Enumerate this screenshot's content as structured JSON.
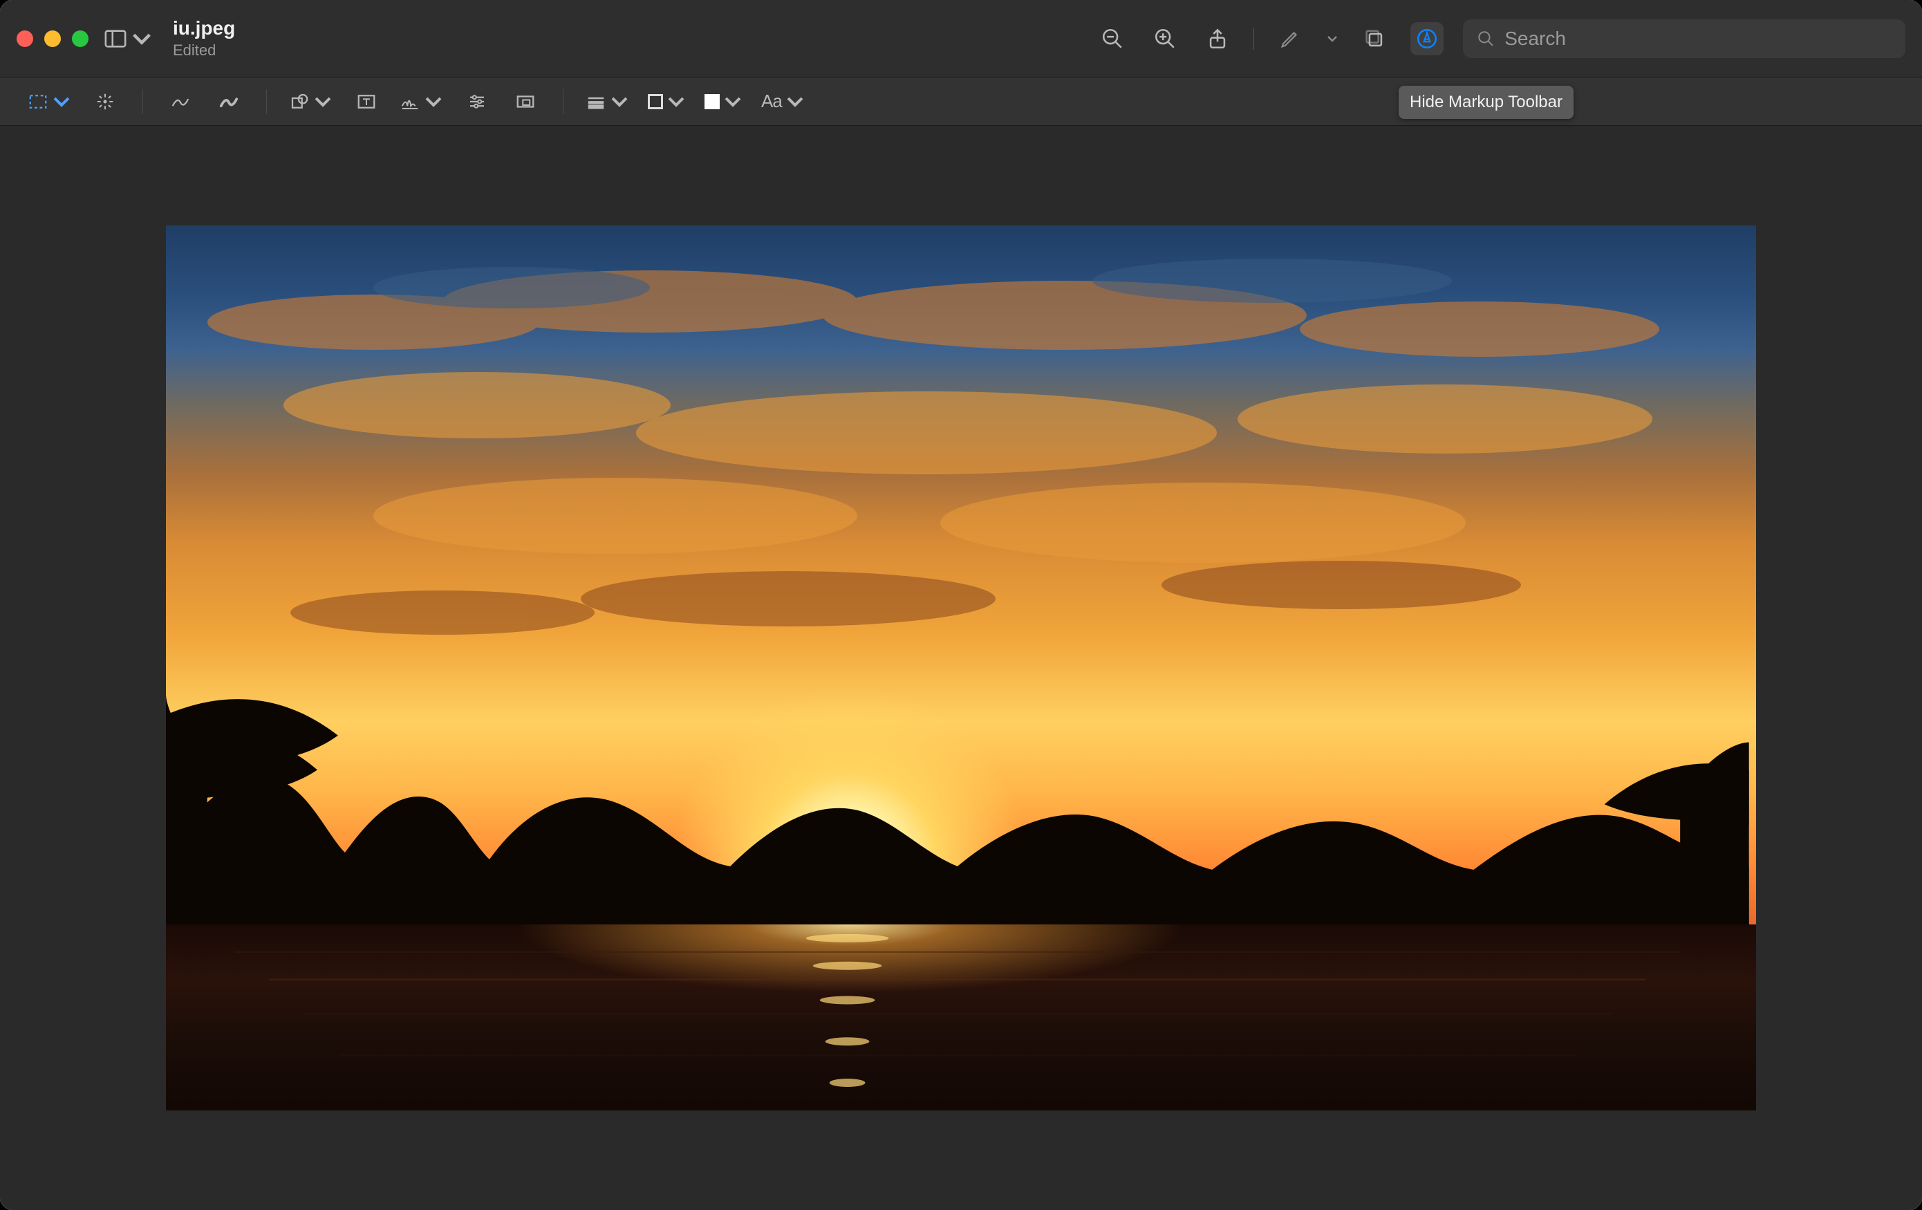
{
  "window": {
    "file_title": "iu.jpeg",
    "subtitle": "Edited"
  },
  "toolbar": {
    "search_placeholder": "Search"
  },
  "tooltip": {
    "markup_toggle": "Hide Markup Toolbar"
  },
  "markup": {
    "shape_style_indicator": "line",
    "text_style_label": "Aa"
  },
  "icons": {
    "sidebar": "sidebar-icon",
    "zoom_out": "zoom-out-icon",
    "zoom_in": "zoom-in-icon",
    "share": "share-icon",
    "highlight": "highlight-icon",
    "rotate": "rotate-icon",
    "markup": "markup-icon",
    "search": "search-icon",
    "select": "rectangular-selection-icon",
    "instant_alpha": "instant-alpha-icon",
    "sketch": "sketch-icon",
    "draw": "draw-icon",
    "shapes": "shapes-icon",
    "text_box": "text-icon",
    "sign": "sign-icon",
    "adjust_color": "adjust-color-icon",
    "adjust_size": "adjust-size-icon",
    "shape_style": "shape-style-icon",
    "border_color": "border-color-icon",
    "fill_color": "fill-color-icon",
    "text_style": "text-style-icon"
  },
  "image": {
    "description": "Sunset over water with silhouetted trees and dramatic orange clouds",
    "dominant_colors": [
      "#1f3e66",
      "#d98b35",
      "#ffcf60",
      "#e05a24",
      "#3a1508"
    ]
  }
}
